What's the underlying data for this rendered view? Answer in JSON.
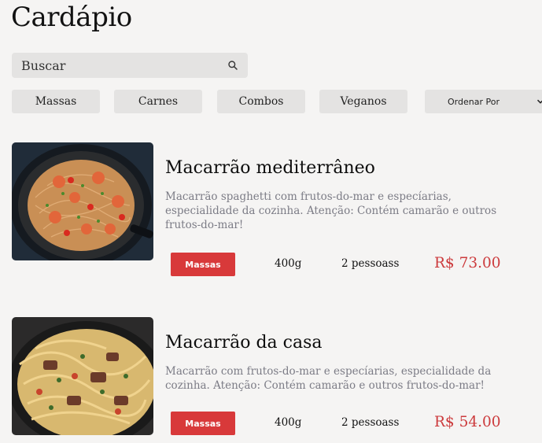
{
  "page": {
    "title": "Cardápio"
  },
  "search": {
    "placeholder": "Buscar"
  },
  "filters": [
    "Massas",
    "Carnes",
    "Combos",
    "Veganos"
  ],
  "sort": {
    "label": "Ordenar Por"
  },
  "items": [
    {
      "title": "Macarrão mediterrâneo",
      "description": "Macarrão spaghetti com frutos-do-mar e especíarias, especialidade da cozinha. Atenção: Contém camarão e outros frutos-do-mar!",
      "category": "Massas",
      "weight": "400g",
      "serves": "2 pessoass",
      "price": "R$ 73.00"
    },
    {
      "title": "Macarrão da casa",
      "description": "Macarrão com frutos-do-mar e especíarias, especialidade da cozinha. Atenção: Contém camarão e outros frutos-do-mar!",
      "category": "Massas",
      "weight": "400g",
      "serves": "2 pessoass",
      "price": "R$ 54.00"
    }
  ],
  "colors": {
    "background": "#f5f4f3",
    "control_bg": "#e4e3e2",
    "badge": "#d8393a",
    "price": "#cc3a3c",
    "description": "#7c7c86"
  }
}
